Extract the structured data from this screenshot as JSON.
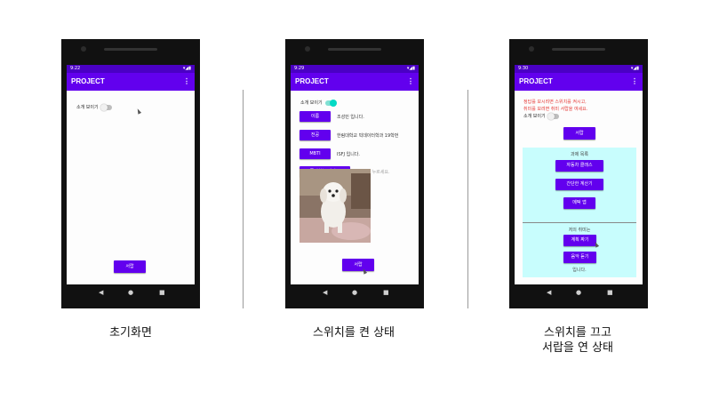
{
  "phones": [
    {
      "time": "9:22",
      "app_title": "PROJECT",
      "switch_label": "소개 보이기",
      "switch_on": false,
      "drawer_button": "서랍"
    },
    {
      "time": "9:29",
      "app_title": "PROJECT",
      "switch_label": "소개 보이기",
      "switch_on": true,
      "rows": [
        {
          "button": "이름",
          "text": "조성민 입니다."
        },
        {
          "button": "전공",
          "text": "한림대학교 빅데이터학과 19학번"
        },
        {
          "button": "MBTI",
          "text": "ISFJ 입니다."
        },
        {
          "button": "즐겨찾는 사이트",
          "text": "버튼을 꾹 누르세요."
        }
      ],
      "drawer_button": "서랍"
    },
    {
      "time": "9:30",
      "app_title": "PROJECT",
      "warning_line1": "정답를 보시려면 스위치를 켜시고,",
      "warning_line2": "취미를 보려면 취미 서랍을 여세요.",
      "switch_label": "소개 보이기",
      "switch_on": false,
      "drawer_button": "서랍",
      "assignments_title": "과제 목록",
      "assignment_buttons": [
        "자동차 클래스",
        "간단한 계산기",
        "메떡 앱"
      ],
      "hobby_title": "저의 취미는",
      "hobby_buttons": [
        "계획 짜기",
        "음악 듣기"
      ],
      "hobby_suffix": "입니다."
    }
  ],
  "captions": {
    "phone1": "초기화면",
    "phone2": "스위치를 켠 상태",
    "phone3_line1": "스위치를 끄고",
    "phone3_line2": "서랍을 연 상태"
  },
  "colors": {
    "primary": "#6200ee",
    "status_bar": "#4a00c4",
    "switch_on": "#03dac5",
    "warning_text": "#e53935",
    "drawer_panel": "#c8fdfd"
  }
}
